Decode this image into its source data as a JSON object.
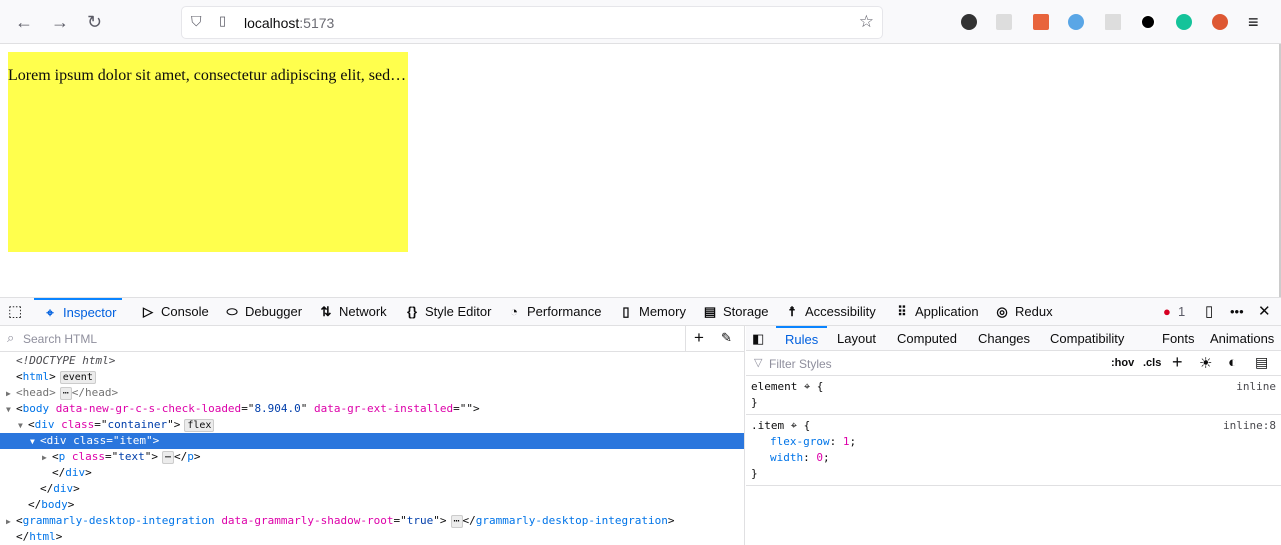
{
  "browser": {
    "url_host": "localhost",
    "url_port": ":5173",
    "icons": [
      "back-icon",
      "forward-icon",
      "reload-icon",
      "shield-icon",
      "page-icon",
      "bookmark-star-icon",
      "menu-icon"
    ],
    "extensions": [
      "extension-anime-icon",
      "extension-react-icon",
      "extension-org-icon",
      "extension-vimeo-icon",
      "extension-doc-icon",
      "extension-block-icon",
      "extension-grammarly-icon",
      "extension-duckduckgo-icon"
    ]
  },
  "page": {
    "item_text": "Lorem ipsum dolor sit amet, consectetur adipiscing elit, sed…",
    "item_color": "#ffff4d"
  },
  "devtools": {
    "tabs": [
      {
        "label": "Inspector",
        "icon": "⌖"
      },
      {
        "label": "Console",
        "icon": "▷"
      },
      {
        "label": "Debugger",
        "icon": "⬭"
      },
      {
        "label": "Network",
        "icon": "⇅"
      },
      {
        "label": "Style Editor",
        "icon": "{}"
      },
      {
        "label": "Performance",
        "icon": "◔"
      },
      {
        "label": "Memory",
        "icon": "▯"
      },
      {
        "label": "Storage",
        "icon": "▤"
      },
      {
        "label": "Accessibility",
        "icon": "☨"
      },
      {
        "label": "Application",
        "icon": "⠿"
      },
      {
        "label": "Redux",
        "icon": "◎"
      }
    ],
    "error_count": "1",
    "search_placeholder": "Search HTML",
    "markup": [
      {
        "indent": 0,
        "tri": "",
        "tokens": [
          [
            "it",
            "<!DOCTYPE html>"
          ]
        ]
      },
      {
        "indent": 0,
        "tri": "",
        "tokens": [
          [
            "pun",
            "<"
          ],
          [
            "tag",
            "html"
          ],
          [
            "pun",
            ">"
          ],
          [
            "badge",
            "event"
          ]
        ]
      },
      {
        "indent": 0,
        "tri": "▶",
        "tokens": [
          [
            "gray",
            "<head>"
          ],
          [
            "badge",
            "⋯"
          ],
          [
            "gray",
            "</head>"
          ]
        ]
      },
      {
        "indent": 0,
        "tri": "▼",
        "tokens": [
          [
            "pun",
            "<"
          ],
          [
            "tag",
            "body"
          ],
          [
            "pun",
            " "
          ],
          [
            "attr",
            "data-new-gr-c-s-check-loaded"
          ],
          [
            "pun",
            "=\""
          ],
          [
            "val",
            "8.904.0"
          ],
          [
            "pun",
            "\" "
          ],
          [
            "attr",
            "data-gr-ext-installed"
          ],
          [
            "pun",
            "=\"\">"
          ]
        ]
      },
      {
        "indent": 1,
        "tri": "▼",
        "tokens": [
          [
            "pun",
            "<"
          ],
          [
            "tag",
            "div"
          ],
          [
            "pun",
            " "
          ],
          [
            "attr",
            "class"
          ],
          [
            "pun",
            "=\""
          ],
          [
            "val",
            "container"
          ],
          [
            "pun",
            "\">"
          ],
          [
            "badge",
            "flex"
          ]
        ]
      },
      {
        "indent": 2,
        "tri": "▼",
        "sel": true,
        "tokens": [
          [
            "pun",
            "<"
          ],
          [
            "tag",
            "div"
          ],
          [
            "pun",
            " "
          ],
          [
            "attr",
            "class"
          ],
          [
            "pun",
            "=\""
          ],
          [
            "val",
            "item"
          ],
          [
            "pun",
            "\">"
          ]
        ]
      },
      {
        "indent": 3,
        "tri": "▶",
        "tokens": [
          [
            "pun",
            "<"
          ],
          [
            "tag",
            "p"
          ],
          [
            "pun",
            " "
          ],
          [
            "attr",
            "class"
          ],
          [
            "pun",
            "=\""
          ],
          [
            "val",
            "text"
          ],
          [
            "pun",
            "\">"
          ],
          [
            "badge",
            "⋯"
          ],
          [
            "pun",
            "</"
          ],
          [
            "tag",
            "p"
          ],
          [
            "pun",
            ">"
          ]
        ]
      },
      {
        "indent": 3,
        "tri": "",
        "tokens": [
          [
            "pun",
            "</"
          ],
          [
            "tag",
            "div"
          ],
          [
            "pun",
            ">"
          ]
        ]
      },
      {
        "indent": 2,
        "tri": "",
        "tokens": [
          [
            "pun",
            "</"
          ],
          [
            "tag",
            "div"
          ],
          [
            "pun",
            ">"
          ]
        ]
      },
      {
        "indent": 1,
        "tri": "",
        "tokens": [
          [
            "pun",
            "</"
          ],
          [
            "tag",
            "body"
          ],
          [
            "pun",
            ">"
          ]
        ]
      },
      {
        "indent": 0,
        "tri": "▶",
        "tokens": [
          [
            "pun",
            "<"
          ],
          [
            "tag",
            "grammarly-desktop-integration"
          ],
          [
            "pun",
            " "
          ],
          [
            "attr",
            "data-grammarly-shadow-root"
          ],
          [
            "pun",
            "=\""
          ],
          [
            "val",
            "true"
          ],
          [
            "pun",
            "\">"
          ],
          [
            "badge",
            "⋯"
          ],
          [
            "pun",
            "</"
          ],
          [
            "tag",
            "grammarly-desktop-integration"
          ],
          [
            "pun",
            ">"
          ]
        ]
      },
      {
        "indent": 0,
        "tri": "",
        "tokens": [
          [
            "pun",
            "</"
          ],
          [
            "tag",
            "html"
          ],
          [
            "pun",
            ">"
          ]
        ]
      }
    ],
    "side_tabs": [
      "Rules",
      "Layout",
      "Computed",
      "Changes",
      "Compatibility",
      "Fonts",
      "Animations"
    ],
    "filter_placeholder": "Filter Styles",
    "hov": ":hov",
    "cls": ".cls",
    "rules": [
      {
        "selector": "element",
        "source": "inline",
        "decls": []
      },
      {
        "selector": ".item",
        "source": "inline:8",
        "decls": [
          {
            "prop": "flex-grow",
            "value": "1"
          },
          {
            "prop": "width",
            "value": "0"
          }
        ]
      }
    ]
  }
}
